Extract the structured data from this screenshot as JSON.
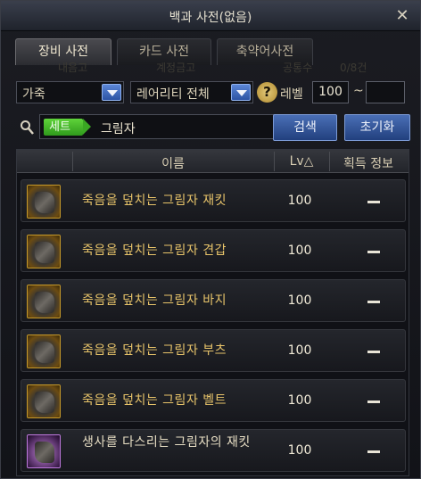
{
  "window": {
    "title": "백과 사전(없음)",
    "close_icon": "close-icon"
  },
  "tabs": [
    {
      "label": "장비 사전",
      "active": true
    },
    {
      "label": "카드 사전",
      "active": false
    },
    {
      "label": "축약어사전",
      "active": false
    }
  ],
  "ghost_labels": [
    "내음고",
    "계정금고",
    "공통수",
    "0/8건"
  ],
  "filters": {
    "category": "가죽",
    "rarity": "레어리티 전체",
    "level_label": "레벨",
    "level_min": "100",
    "level_separator": "~",
    "level_max": ""
  },
  "search": {
    "tag": "세트",
    "query": "그림자",
    "search_button": "검색",
    "reset_button": "초기화"
  },
  "table": {
    "headers": {
      "name": "이름",
      "level": "Lv△",
      "acquire": "획득 정보"
    },
    "rows": [
      {
        "name": "죽음을 덮치는 그림자 재킷",
        "level": "100",
        "acquire": "—",
        "rarity": "unique"
      },
      {
        "name": "죽음을 덮치는 그림자 견갑",
        "level": "100",
        "acquire": "—",
        "rarity": "unique"
      },
      {
        "name": "죽음을 덮치는 그림자 바지",
        "level": "100",
        "acquire": "—",
        "rarity": "unique"
      },
      {
        "name": "죽음을 덮치는 그림자 부츠",
        "level": "100",
        "acquire": "—",
        "rarity": "unique"
      },
      {
        "name": "죽음을 덮치는 그림자 벨트",
        "level": "100",
        "acquire": "—",
        "rarity": "unique"
      },
      {
        "name": "생사를 다스리는 그림자의 재킷",
        "level": "100",
        "acquire": "—",
        "rarity": "epic"
      }
    ]
  },
  "colors": {
    "unique_text": "#e8c46a",
    "epic_text": "#e6ddc3",
    "accent_blue": "#2c53a3",
    "set_tag_green": "#3aa823"
  }
}
